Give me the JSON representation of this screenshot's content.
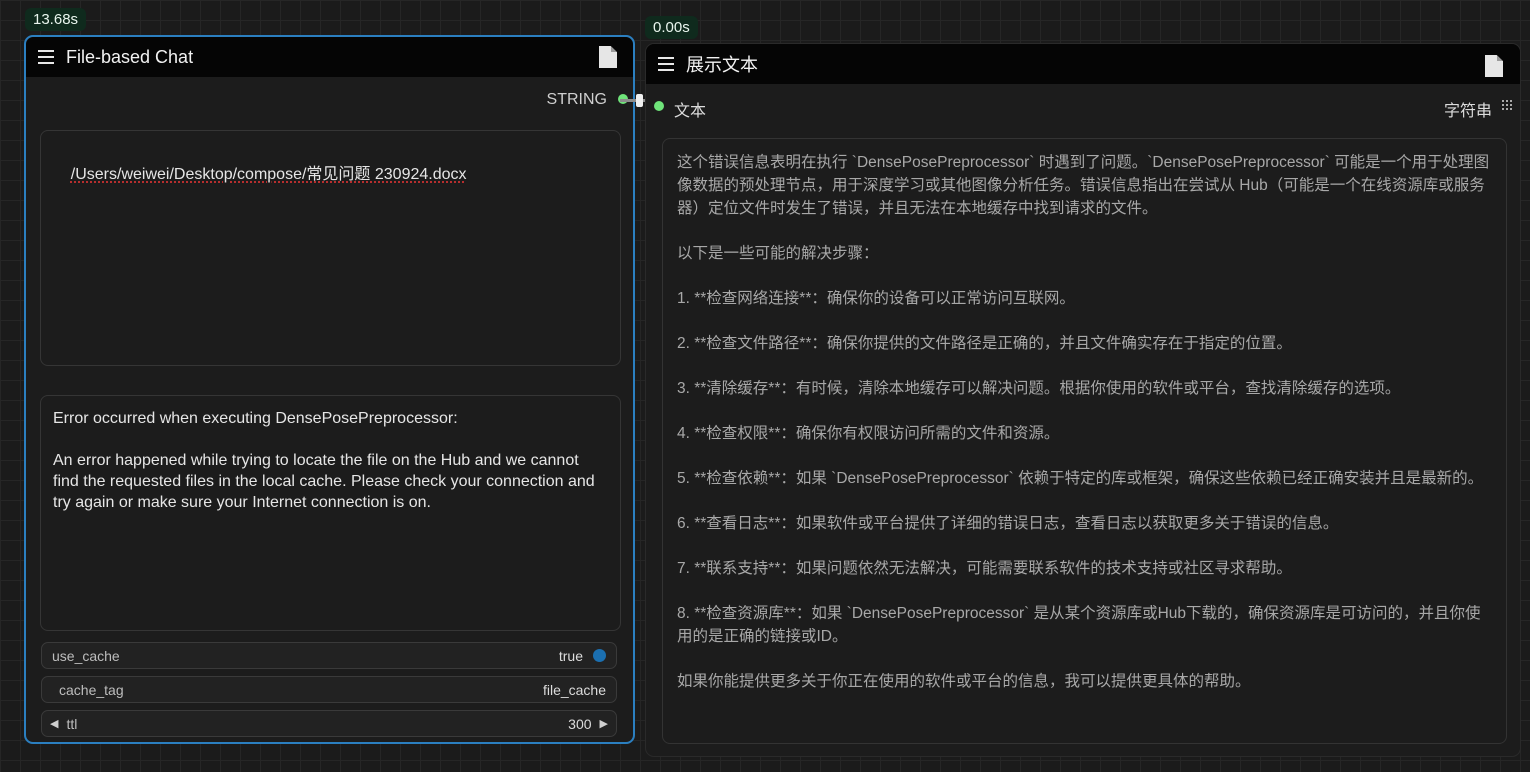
{
  "left_node": {
    "time_badge": "13.68s",
    "title": "File-based Chat",
    "output_label": "STRING",
    "file_path": "/Users/weiwei/Desktop/compose/常见问题 230924.docx",
    "error_text": "Error occurred when executing DensePosePreprocessor:\n\nAn error happened while trying to locate the file on the Hub and we cannot find the requested files in the local cache. Please check your connection and try again or make sure your Internet connection is on.",
    "widgets": {
      "use_cache": {
        "label": "use_cache",
        "value": "true"
      },
      "cache_tag": {
        "label": "cache_tag",
        "value": "file_cache"
      },
      "ttl": {
        "label": "ttl",
        "value": "300"
      }
    }
  },
  "right_node": {
    "time_badge": "0.00s",
    "title": "展示文本",
    "input_label": "文本",
    "input_type": "字符串",
    "paragraphs": [
      "这个错误信息表明在执行 `DensePosePreprocessor` 时遇到了问题。`DensePosePreprocessor` 可能是一个用于处理图像数据的预处理节点，用于深度学习或其他图像分析任务。错误信息指出在尝试从 Hub（可能是一个在线资源库或服务器）定位文件时发生了错误，并且无法在本地缓存中找到请求的文件。",
      "以下是一些可能的解决步骤：",
      "1. **检查网络连接**：确保你的设备可以正常访问互联网。",
      "2. **检查文件路径**：确保你提供的文件路径是正确的，并且文件确实存在于指定的位置。",
      "3. **清除缓存**：有时候，清除本地缓存可以解决问题。根据你使用的软件或平台，查找清除缓存的选项。",
      "4. **检查权限**：确保你有权限访问所需的文件和资源。",
      "5. **检查依赖**：如果 `DensePosePreprocessor` 依赖于特定的库或框架，确保这些依赖已经正确安装并且是最新的。",
      "6. **查看日志**：如果软件或平台提供了详细的错误日志，查看日志以获取更多关于错误的信息。",
      "7. **联系支持**：如果问题依然无法解决，可能需要联系软件的技术支持或社区寻求帮助。",
      "8. **检查资源库**：如果 `DensePosePreprocessor` 是从某个资源库或Hub下载的，确保资源库是可访问的，并且你使用的是正确的链接或ID。",
      "如果你能提供更多关于你正在使用的软件或平台的信息，我可以提供更具体的帮助。"
    ]
  },
  "colors": {
    "selected_border": "#2b7fc0",
    "slot_dot": "#6fe47a",
    "badge_bg": "#0f2a1d",
    "toggle_on": "#1b6fb0"
  }
}
